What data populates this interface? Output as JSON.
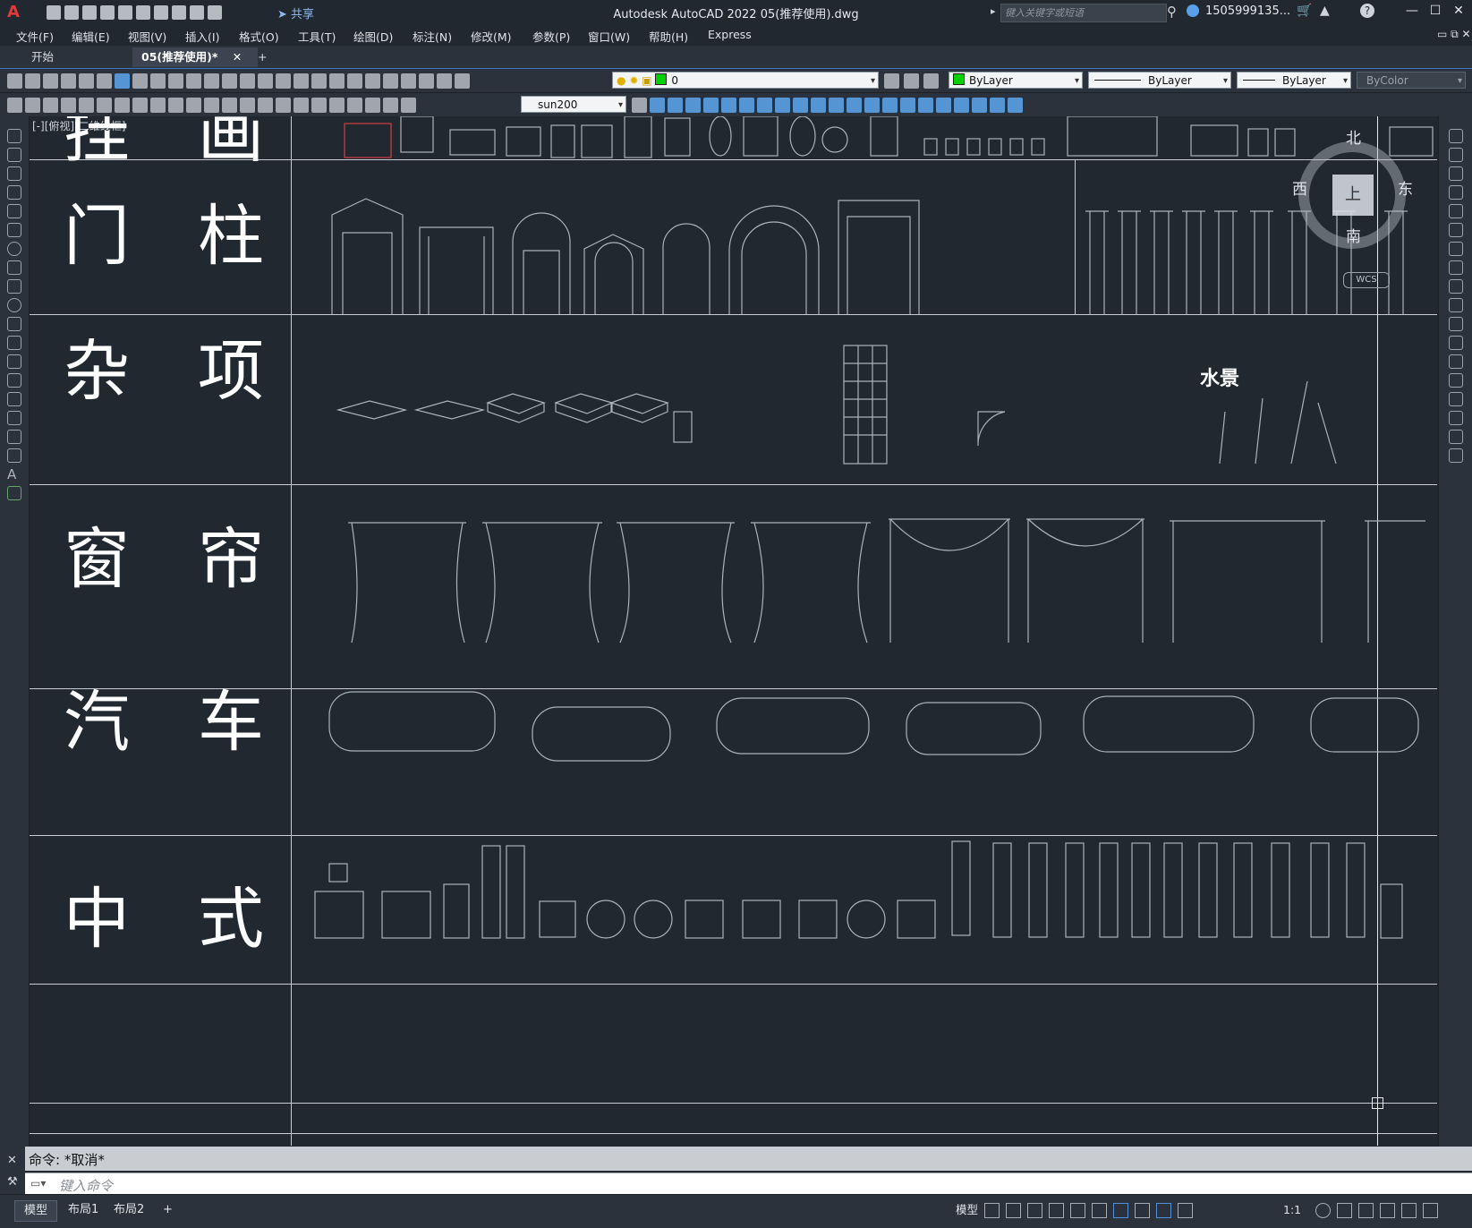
{
  "titlebar": {
    "app_letter": "A",
    "share_label": "共享",
    "window_title": "Autodesk AutoCAD 2022    05(推荐使用).dwg",
    "search_placeholder": "键入关键字或短语",
    "user": "1505999135...",
    "minimize": "—",
    "maximize": "☐",
    "close": "✕"
  },
  "menu": [
    "文件(F)",
    "编辑(E)",
    "视图(V)",
    "插入(I)",
    "格式(O)",
    "工具(T)",
    "绘图(D)",
    "标注(N)",
    "修改(M)",
    "参数(P)",
    "窗口(W)",
    "帮助(H)",
    "Express"
  ],
  "doc_tabs": {
    "start": "开始",
    "current": "05(推荐使用)*",
    "close_glyph": "✕",
    "new_glyph": "+"
  },
  "properties": {
    "layer_value": "0",
    "color_value": "ByLayer",
    "linetype_value": "ByLayer",
    "lineweight_value": "ByLayer",
    "plotstyle_value": "ByColor",
    "dimstyle_value": "sun200"
  },
  "colors": {
    "layer_swatch": "#00d000",
    "accent": "#3a78c4",
    "canvas": "#212830"
  },
  "viewport_label": "[-][俯视][二维线框]",
  "categories": [
    {
      "left": "挂",
      "right": "画"
    },
    {
      "left": "门",
      "right": "柱"
    },
    {
      "left": "杂",
      "right": "项"
    },
    {
      "left": "窗",
      "right": "帘"
    },
    {
      "left": "汽",
      "right": "车"
    },
    {
      "left": "中",
      "right": "式"
    }
  ],
  "drawing_text": {
    "water_feature": "水景"
  },
  "viewcube": {
    "north": "北",
    "south": "南",
    "east": "东",
    "west": "西",
    "top": "上",
    "wcs": "WCS"
  },
  "command": {
    "history": "命令:  *取消*",
    "placeholder": "键入命令"
  },
  "layout_tabs": [
    "模型",
    "布局1",
    "布局2"
  ],
  "layout_add": "+",
  "status": {
    "model_label": "模型",
    "scale": "1:1"
  },
  "icons": [
    "autocad-logo-icon",
    "new-file-icon",
    "open-file-icon",
    "save-icon",
    "print-icon",
    "undo-icon",
    "redo-icon",
    "share-icon",
    "search-icon",
    "user-icon",
    "cart-icon",
    "help-icon",
    "lightbulb-icon",
    "sun-icon",
    "lock-icon",
    "close-icon",
    "wrench-icon",
    "grid-icon",
    "snap-icon",
    "ortho-icon",
    "polar-icon",
    "gear-icon",
    "crosshair-icon",
    "fullscreen-icon",
    "menu-icon"
  ]
}
